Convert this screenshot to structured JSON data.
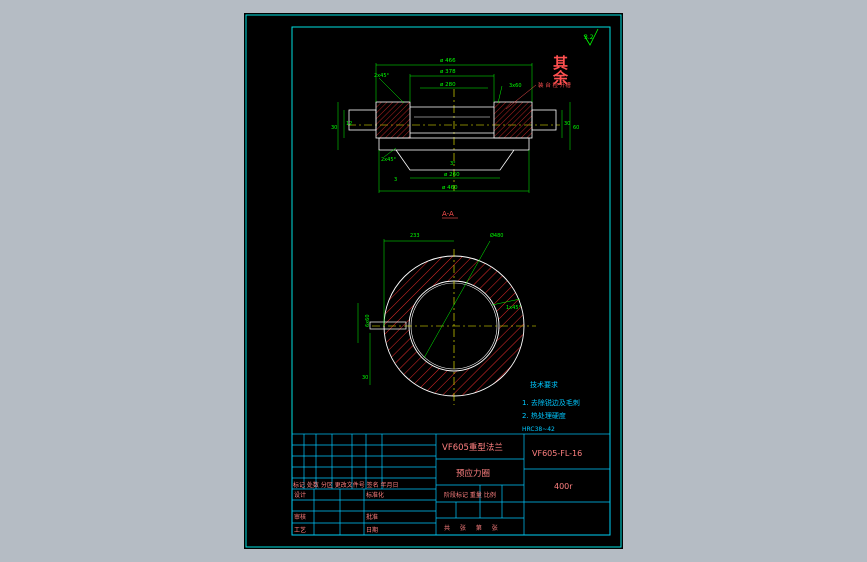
{
  "colors": {
    "background": "#b5bcc4",
    "sheet": "#000000",
    "frame": "#00e0e0",
    "title_block": "#00c8ff",
    "body_outline": "#ffffff",
    "dimension": "#00ff00",
    "hatch": "#ff3030",
    "center_line": "#ffff00",
    "annotation": "#ff5050",
    "block_text_main": "#ff8080",
    "block_text_label": "#ff8080"
  },
  "top_view": {
    "dims": {
      "d_top": "ø 466",
      "d_second": "ø 378",
      "d_third": "ø 280",
      "chamfer_top": "2x45°",
      "chamfer_bottom": "2x45°",
      "groove": "3x60",
      "d_bottom_1": "ø 260",
      "d_bottom_2": "ø 460",
      "left_h_1": "12",
      "left_h_2": "30",
      "right_h_1": "30",
      "right_h_2": "60",
      "angle": "3°",
      "lower_mark": "3"
    },
    "note_right": "装 台 检 开槽"
  },
  "section_view": {
    "label": "A-A",
    "dim_top": "233",
    "dim_diameter": "Ø480",
    "dim_left": "6x60",
    "dim_right": "1x45°",
    "dim_bottom_left": "30"
  },
  "roughness": {
    "word": "其余",
    "symbol_value": "3.2"
  },
  "tech_requirements": {
    "title": "技术要求",
    "items": [
      "1. 去除锐边及毛刺",
      "2. 热处理硬度"
    ],
    "hardness": "HRC38~42"
  },
  "title_block": {
    "part_name_1": "VF605重型法兰",
    "part_name_2": "预应力圈",
    "drawing_no": "VF605-FL-16",
    "material": "400r",
    "header_row": "标记 处数 分区 更改文件号 签名 年月日",
    "row_design": "设计",
    "row_std": "标准化",
    "row_check": "审核",
    "row_craft": "工艺",
    "row_approve_1": "批准",
    "row_approve_2": "日期",
    "stage_labels": "阶段标记 重量 比例",
    "sheet_info": "共 张 第 张"
  }
}
